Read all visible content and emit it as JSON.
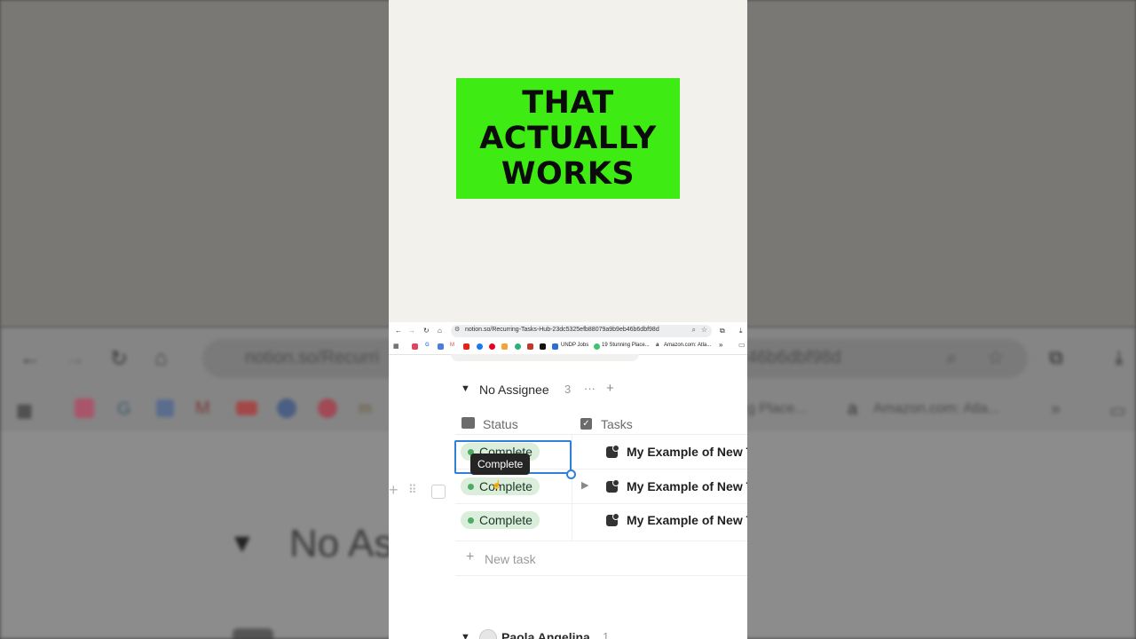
{
  "browser": {
    "url": "notion.so/Recurring-Tasks-Hub-23dc5325efb88079a9b9eb46b6dbf98d",
    "bookmarks": [
      "UNDP Jobs",
      "19 Stunning Place...",
      "Amazon.com: Atla..."
    ],
    "more_bookmarks": "»"
  },
  "background": {
    "url_fragment": "notion.so/Recurri",
    "url_tail": "46b6dbf98d",
    "bookmark_places": "g Place...",
    "bookmark_amazon": "Amazon.com: Atla...",
    "group_fragment": "No As"
  },
  "banner": {
    "lines": [
      "THAT",
      "ACTUALLY",
      "WORKS"
    ],
    "color": "#3eeb12"
  },
  "group": {
    "title": "No Assignee",
    "count": "3",
    "more_label": "···",
    "add_label": "+"
  },
  "columns": {
    "status": "Status",
    "tasks": "Tasks"
  },
  "rows": [
    {
      "status": "Complete",
      "task": "My Example of New T"
    },
    {
      "status": "Complete",
      "task": "My Example of New T"
    },
    {
      "status": "Complete",
      "task": "My Example of New T"
    }
  ],
  "tooltip": "Complete",
  "new_task": "New task",
  "next_group": {
    "title": "Paola Angelina",
    "count": "1"
  },
  "colors": {
    "status_green_bg": "#dbeddb",
    "status_green_dot": "#4dab64",
    "selection_blue": "#2f80d8"
  }
}
